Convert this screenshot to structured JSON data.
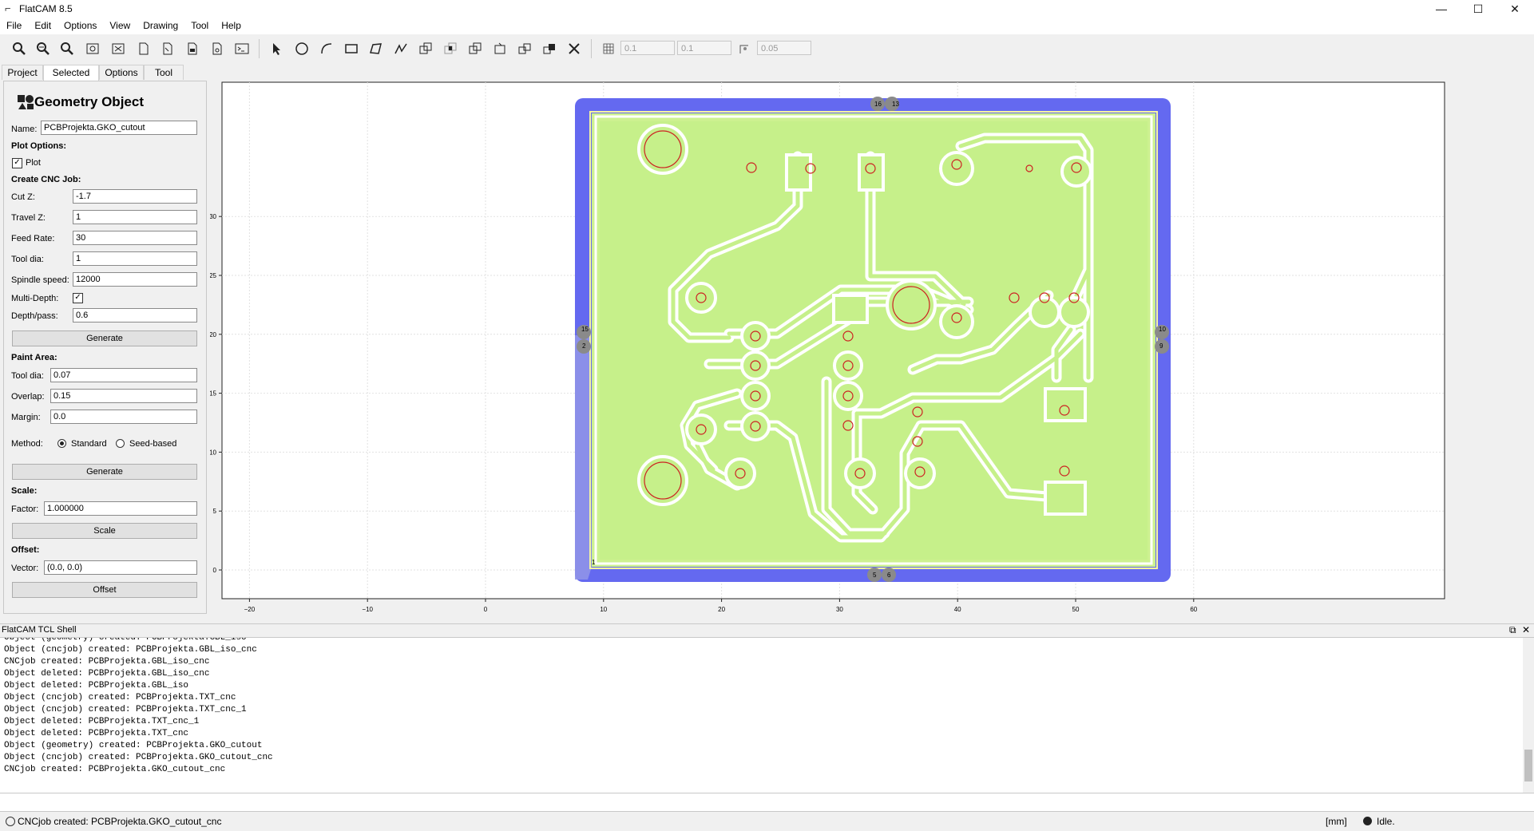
{
  "window": {
    "title": "FlatCAM 8.5",
    "minimize": "—",
    "maximize": "☐",
    "close": "✕"
  },
  "menu": [
    "File",
    "Edit",
    "Options",
    "View",
    "Drawing",
    "Tool",
    "Help"
  ],
  "toolbar": {
    "grid_x": "0.1",
    "grid_y": "0.1",
    "snap_max": "0.05"
  },
  "tabs": [
    "Project",
    "Selected",
    "Options",
    "Tool"
  ],
  "active_tab": "Selected",
  "panel": {
    "title": "Geometry Object",
    "name_label": "Name:",
    "name_value": "PCBProjekta.GKO_cutout",
    "plot_options": "Plot Options:",
    "plot_label": "Plot",
    "plot_checked": true,
    "cnc_heading": "Create CNC Job:",
    "cut_z_label": "Cut Z:",
    "cut_z": "-1.7",
    "travel_z_label": "Travel Z:",
    "travel_z": "1",
    "feed_rate_label": "Feed Rate:",
    "feed_rate": "30",
    "tool_dia_label": "Tool dia:",
    "tool_dia": "1",
    "spindle_label": "Spindle speed:",
    "spindle": "12000",
    "multidepth_label": "Multi-Depth:",
    "multidepth_checked": true,
    "depth_pass_label": "Depth/pass:",
    "depth_pass": "0.6",
    "generate_label": "Generate",
    "paint_heading": "Paint Area:",
    "paint_tool_dia_label": "Tool dia:",
    "paint_tool_dia": "0.07",
    "overlap_label": "Overlap:",
    "overlap": "0.15",
    "margin_label": "Margin:",
    "margin": "0.0",
    "method_label": "Method:",
    "method_standard": "Standard",
    "method_seed": "Seed-based",
    "paint_generate_label": "Generate",
    "scale_heading": "Scale:",
    "factor_label": "Factor:",
    "factor": "1.000000",
    "scale_button": "Scale",
    "offset_heading": "Offset:",
    "vector_label": "Vector:",
    "vector": "(0.0, 0.0)",
    "offset_button": "Offset"
  },
  "plot": {
    "x_ticks": [
      "−20",
      "−10",
      "0",
      "10",
      "20",
      "30",
      "40",
      "50",
      "60"
    ],
    "y_ticks": [
      "0",
      "5",
      "10",
      "15",
      "20",
      "25",
      "30"
    ],
    "tab_labels": {
      "top_left": "16",
      "top_right": "13",
      "left_top": "15",
      "left_bottom": "2",
      "right_top": "10",
      "right_bottom": "9",
      "bottom_left": "5",
      "bottom_right": "6",
      "origin": "1"
    },
    "colors": {
      "board": "#ccf28a",
      "cutout": "#6469f0",
      "hole": "#cc2222",
      "isolation": "#ffffff"
    }
  },
  "shell": {
    "title": "FlatCAM TCL Shell",
    "lines": [
      "Object (geometry) created: PCBProjekta.GBL_iso",
      "Object (cncjob) created: PCBProjekta.GBL_iso_cnc",
      "CNCjob created: PCBProjekta.GBL_iso_cnc",
      "Object deleted: PCBProjekta.GBL_iso_cnc",
      "Object deleted: PCBProjekta.GBL_iso",
      "Object (cncjob) created: PCBProjekta.TXT_cnc",
      "Object (cncjob) created: PCBProjekta.TXT_cnc_1",
      "Object deleted: PCBProjekta.TXT_cnc_1",
      "Object deleted: PCBProjekta.TXT_cnc",
      "Object (geometry) created: PCBProjekta.GKO_cutout",
      "Object (cncjob) created: PCBProjekta.GKO_cutout_cnc",
      "CNCjob created: PCBProjekta.GKO_cutout_cnc"
    ]
  },
  "status": {
    "message": "CNCjob created: PCBProjekta.GKO_cutout_cnc",
    "units": "[mm]",
    "state": "Idle."
  }
}
